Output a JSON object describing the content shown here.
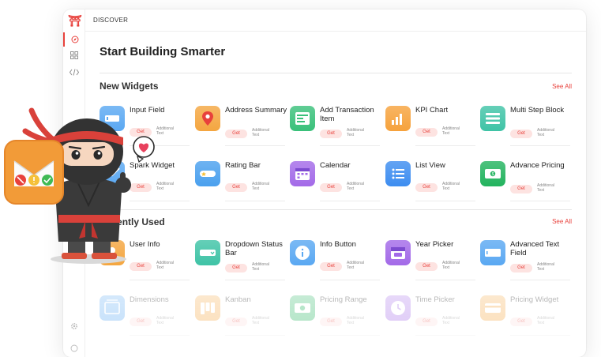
{
  "header": {
    "breadcrumb": "DISCOVER"
  },
  "page_title": "Start Building Smarter",
  "new_widgets": {
    "title": "New Widgets",
    "see_all": "See All",
    "items": [
      {
        "name": "Input Field",
        "get": "Get",
        "sub": "Additional Text",
        "icon": "input-field-icon",
        "color": "#5aa8f2"
      },
      {
        "name": "Address Summary",
        "get": "Get",
        "sub": "Additional Text",
        "icon": "map-pin-icon",
        "color": "#f4a640"
      },
      {
        "name": "Add Transaction Item",
        "get": "Get",
        "sub": "Additional Text",
        "icon": "transaction-icon",
        "color": "#39c07a"
      },
      {
        "name": "KPI Chart",
        "get": "Get",
        "sub": "Additional Text",
        "icon": "kpi-chart-icon",
        "color": "#f6a23c"
      },
      {
        "name": "Multi Step Block",
        "get": "Get",
        "sub": "Additional Text",
        "icon": "multi-step-icon",
        "color": "#3fc3a6"
      },
      {
        "name": "Spark Widget",
        "get": "Get",
        "sub": "Additional Text",
        "icon": "spark-icon",
        "color": "#5aa8f2"
      },
      {
        "name": "Rating Bar",
        "get": "Get",
        "sub": "Additional Text",
        "icon": "star-rating-icon",
        "color": "#4aa0ee"
      },
      {
        "name": "Calendar",
        "get": "Get",
        "sub": "Additional Text",
        "icon": "calendar-icon",
        "color": "#a36ae8"
      },
      {
        "name": "List View",
        "get": "Get",
        "sub": "Additional Text",
        "icon": "list-icon",
        "color": "#3d8df0"
      },
      {
        "name": "Advance Pricing",
        "get": "Get",
        "sub": "Additional Text",
        "icon": "pricing-icon",
        "color": "#22b35e"
      }
    ]
  },
  "recently_used": {
    "title": "Recently Used",
    "see_all": "See All",
    "items": [
      {
        "name": "User Info",
        "get": "Get",
        "sub": "Additional Text",
        "icon": "user-info-icon",
        "color": "#f4a640"
      },
      {
        "name": "Dropdown Status Bar",
        "get": "Get",
        "sub": "Additional Text",
        "icon": "dropdown-icon",
        "color": "#3fc3a6"
      },
      {
        "name": "Info Button",
        "get": "Get",
        "sub": "Additional Text",
        "icon": "info-icon",
        "color": "#5aa8f2"
      },
      {
        "name": "Year Picker",
        "get": "Get",
        "sub": "Additional Text",
        "icon": "year-picker-icon",
        "color": "#a36ae8"
      },
      {
        "name": "Advanced Text Field",
        "get": "Get",
        "sub": "Additional Text",
        "icon": "text-field-icon",
        "color": "#5aa8f2"
      },
      {
        "name": "Dimensions",
        "get": "Get",
        "sub": "Additional Text",
        "icon": "dimensions-icon",
        "color": "#5aa8f2"
      },
      {
        "name": "Kanban",
        "get": "Get",
        "sub": "Additional Text",
        "icon": "kanban-icon",
        "color": "#f4a640"
      },
      {
        "name": "Pricing Range",
        "get": "Get",
        "sub": "Additional Text",
        "icon": "pricing-range-icon",
        "color": "#22b35e"
      },
      {
        "name": "Time Picker",
        "get": "Get",
        "sub": "Additional Text",
        "icon": "clock-icon",
        "color": "#a36ae8"
      },
      {
        "name": "Pricing Widget",
        "get": "Get",
        "sub": "Additional Text",
        "icon": "pricing-widget-icon",
        "color": "#f4a640"
      }
    ]
  },
  "sidebar": {
    "icons": [
      "compass-icon",
      "grid-icon",
      "code-icon",
      "settings-icon",
      "help-icon"
    ]
  },
  "colors": {
    "accent": "#e8413c",
    "get_bg": "#fde3e1"
  }
}
